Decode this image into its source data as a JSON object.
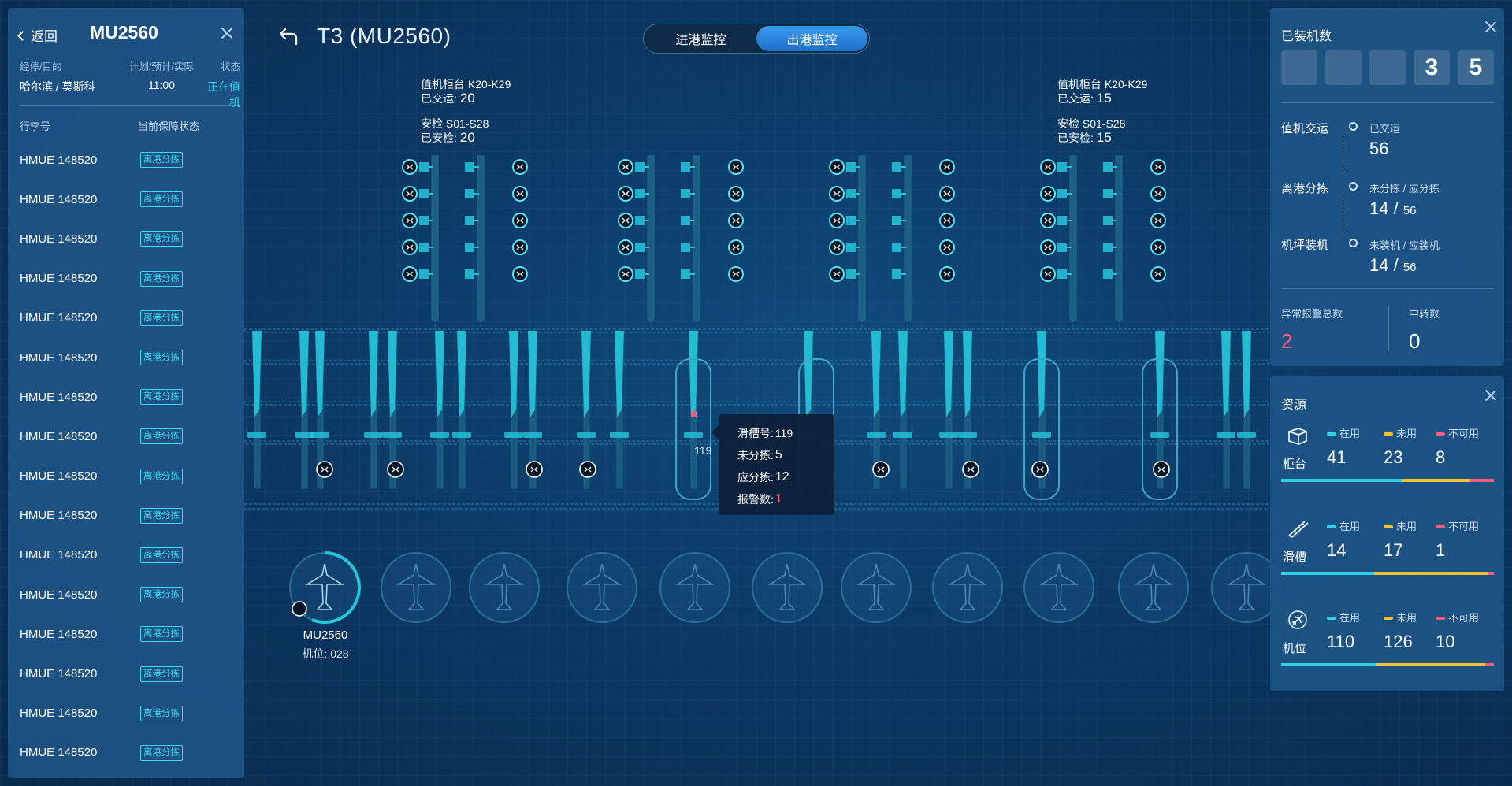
{
  "left_panel": {
    "back_label": "返回",
    "flight_no": "MU2560",
    "headers": {
      "route": "经停/目的",
      "time": "计划/预计/实际",
      "status": "状态"
    },
    "route": "哈尔滨 / 莫斯科",
    "time": "11:00",
    "status": "正在值机",
    "bag_headers": {
      "bag_no": "行李号",
      "state": "当前保障状态"
    },
    "bags": [
      {
        "no": "HMUE 148520",
        "state": "离港分拣"
      },
      {
        "no": "HMUE 148520",
        "state": "离港分拣"
      },
      {
        "no": "HMUE 148520",
        "state": "离港分拣"
      },
      {
        "no": "HMUE 148520",
        "state": "离港分拣"
      },
      {
        "no": "HMUE 148520",
        "state": "离港分拣"
      },
      {
        "no": "HMUE 148520",
        "state": "离港分拣"
      },
      {
        "no": "HMUE 148520",
        "state": "离港分拣"
      },
      {
        "no": "HMUE 148520",
        "state": "离港分拣"
      },
      {
        "no": "HMUE 148520",
        "state": "离港分拣"
      },
      {
        "no": "HMUE 148520",
        "state": "离港分拣"
      },
      {
        "no": "HMUE 148520",
        "state": "离港分拣"
      },
      {
        "no": "HMUE 148520",
        "state": "离港分拣"
      },
      {
        "no": "HMUE 148520",
        "state": "离港分拣"
      },
      {
        "no": "HMUE 148520",
        "state": "离港分拣"
      },
      {
        "no": "HMUE 148520",
        "state": "离港分拣"
      },
      {
        "no": "HMUE 148520",
        "state": "离港分拣"
      }
    ]
  },
  "header": {
    "title": "T3 (MU2560)",
    "tabs": [
      {
        "label": "进港监控"
      },
      {
        "label": "出港监控"
      }
    ]
  },
  "areas": [
    {
      "counter": "值机柜台 K20-K29",
      "checked_label": "已交运:",
      "checked": "20",
      "security": "安检 S01-S28",
      "secured_label": "已安检:",
      "secured": "20"
    },
    {
      "counter": "值机柜台 K20-K29",
      "checked_label": "已交运:",
      "checked": "15",
      "security": "安检 S01-S28",
      "secured_label": "已安检:",
      "secured": "15"
    }
  ],
  "tooltip": {
    "chute_label": "滑槽号:",
    "chute": "119",
    "unsorted_label": "未分拣:",
    "unsorted": "5",
    "should_label": "应分拣:",
    "should": "12",
    "alarm_label": "报警数:",
    "alarm": "1"
  },
  "slot_label": "119",
  "stand": {
    "flight": "MU2560",
    "stand": "机位: 028"
  },
  "loaded": {
    "title": "已装机数",
    "digits": [
      "",
      "",
      "",
      "3",
      "5"
    ],
    "steps": [
      {
        "name": "值机交运",
        "sub": "已交运",
        "val": "56"
      },
      {
        "name": "离港分拣",
        "sub": "未分拣 / 应分拣",
        "val_a": "14",
        "val_b": "56"
      },
      {
        "name": "机坪装机",
        "sub": "未装机 / 应装机",
        "val_a": "14",
        "val_b": "56"
      }
    ],
    "alarm_label": "异常报警总数",
    "alarm_total": "2",
    "transfer_label": "中转数",
    "transfer": "0"
  },
  "resources": {
    "title": "资源",
    "legend": {
      "in_use": "在用",
      "unused": "未用",
      "unavailable": "不可用"
    },
    "colors": {
      "in_use": "#2fd0e6",
      "unused": "#f2c232",
      "unavailable": "#ff5a7a"
    },
    "items": [
      {
        "name": "柜台",
        "icon": "counter-icon",
        "in_use": 41,
        "unused": 23,
        "unavailable": 8
      },
      {
        "name": "滑槽",
        "icon": "chute-icon",
        "in_use": 14,
        "unused": 17,
        "unavailable": 1
      },
      {
        "name": "机位",
        "icon": "plane-icon",
        "in_use": 110,
        "unused": 126,
        "unavailable": 10
      }
    ]
  }
}
